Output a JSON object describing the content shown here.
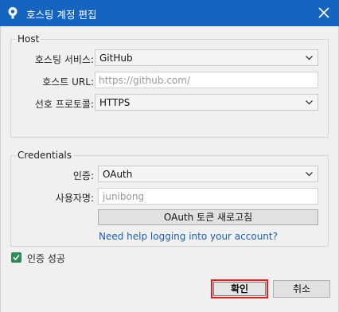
{
  "window": {
    "title": "호스팅 계정 편집",
    "icon": "sourcetree-logo-icon",
    "close_icon": "close-icon",
    "titlebar_color": "#1565c0"
  },
  "host_group": {
    "legend": "Host",
    "service_label": "호스팅 서비스:",
    "service_value": "GitHub",
    "url_label": "호스트 URL:",
    "url_placeholder": "https://github.com/",
    "protocol_label": "선호 프로토콜:",
    "protocol_value": "HTTPS"
  },
  "credentials_group": {
    "legend": "Credentials",
    "auth_label": "인증:",
    "auth_value": "OAuth",
    "username_label": "사용자명:",
    "username_value": "junibong",
    "refresh_button": "OAuth 토큰 새로고침",
    "help_link": "Need help logging into your account?"
  },
  "auth_status": {
    "checked": true,
    "label": "인증 성공",
    "check_color": "#2e8b57"
  },
  "buttons": {
    "ok": "확인",
    "cancel": "취소",
    "ok_highlight_color": "#e02020"
  }
}
